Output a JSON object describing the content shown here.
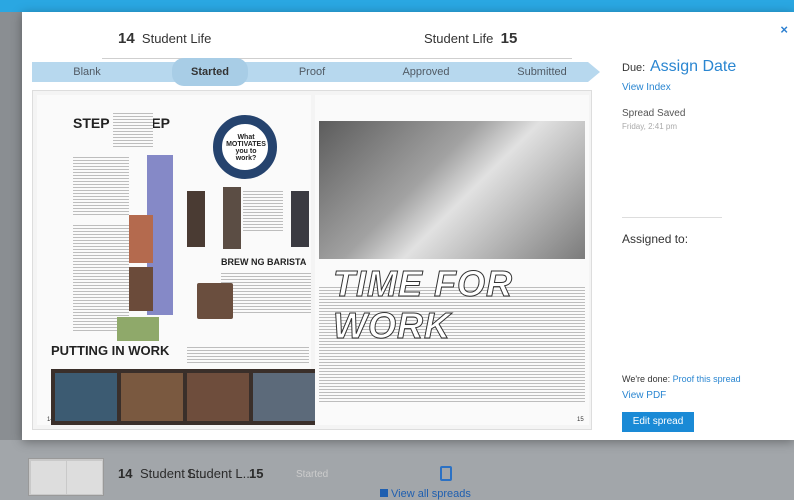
{
  "background": {
    "row": {
      "left_num": "14",
      "left_title": "Student L...",
      "right_title": "Student L...",
      "right_num": "15",
      "status": "Started"
    },
    "view_all": "View all spreads"
  },
  "modal": {
    "close_icon": "×",
    "left_page": {
      "num": "14",
      "title": "Student Life"
    },
    "right_page": {
      "title": "Student Life",
      "num": "15"
    },
    "stages": [
      {
        "label": "Blank",
        "active": false
      },
      {
        "label": "Started",
        "active": true
      },
      {
        "label": "Proof",
        "active": false
      },
      {
        "label": "Approved",
        "active": false
      },
      {
        "label": "Submitted",
        "active": false
      }
    ],
    "spread_text": {
      "step": "STEP by STEP",
      "motivates": "What MOTIVATES you to work?",
      "brewing": "BREW NG BARISTA",
      "putting": "PUTTING IN WORK",
      "time_for_work": "TIME FOR WORK",
      "page_left_num": "14",
      "page_right_num": "15"
    },
    "sidebar": {
      "due_label": "Due:",
      "due_link": "Assign Date",
      "view_index": "View Index",
      "saved_title": "Spread Saved",
      "saved_time": "Friday, 2:41 pm",
      "assigned": "Assigned to:",
      "done_prefix": "We're done:",
      "done_link": "Proof this spread",
      "view_pdf": "View PDF",
      "edit_btn": "Edit spread"
    }
  },
  "colors": {
    "accent": "#2a86d1",
    "ribbon": "#b7d8ee",
    "button": "#1a8ad6"
  }
}
